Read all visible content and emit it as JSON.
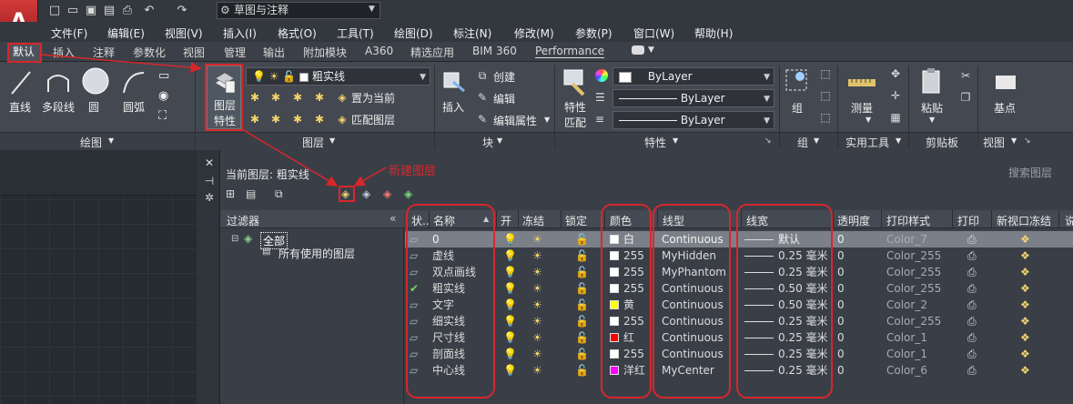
{
  "workspace": "草图与注释",
  "menu": [
    "文件(F)",
    "编辑(E)",
    "视图(V)",
    "插入(I)",
    "格式(O)",
    "工具(T)",
    "绘图(D)",
    "标注(N)",
    "修改(M)",
    "参数(P)",
    "窗口(W)",
    "帮助(H)"
  ],
  "tabs": [
    "默认",
    "插入",
    "注释",
    "参数化",
    "视图",
    "管理",
    "输出",
    "附加模块",
    "A360",
    "精选应用",
    "BIM 360",
    "Performance"
  ],
  "draw_tools": {
    "line": "直线",
    "polyline": "多段线",
    "circle": "圆",
    "arc": "圆弧"
  },
  "layer_tools": {
    "props_line1": "图层",
    "props_line2": "特性",
    "current_layer": "粗实线",
    "set_current": "置为当前",
    "match_layer": "匹配图层"
  },
  "block_tools": {
    "insert": "插入",
    "create": "创建",
    "edit": "编辑",
    "edit_attr": "编辑属性"
  },
  "props": {
    "match_line1": "特性",
    "match_line2": "匹配",
    "color": "ByLayer",
    "linetype": "ByLayer",
    "lineweight": "ByLayer"
  },
  "group_tools": {
    "group": "组"
  },
  "util_tools": {
    "measure": "测量"
  },
  "clip_tools": {
    "paste": "粘贴"
  },
  "base_tools": {
    "base": "基点"
  },
  "panels": {
    "draw": "绘图",
    "layer": "图层",
    "block": "块",
    "props": "特性",
    "group": "组",
    "util": "实用工具",
    "clipboard": "剪贴板",
    "view": "视图"
  },
  "palette": {
    "current_layer_label": "当前图层: 粗实线",
    "search_placeholder": "搜索图层",
    "annotation": "新建图层",
    "filter_header": "过滤器",
    "filter_all": "全部",
    "filter_used": "所有使用的图层"
  },
  "columns": [
    "状..",
    "名称",
    "开",
    "冻结",
    "锁定",
    "颜色",
    "线型",
    "线宽",
    "透明度",
    "打印样式",
    "打印",
    "新视口冻结",
    "说"
  ],
  "layers": [
    {
      "name": "0",
      "color_name": "白",
      "color_hex": "#ffffff",
      "linetype": "Continuous",
      "lineweight": "默认",
      "transparency": "0",
      "plot_style": "Color_7",
      "current": false,
      "selected": true
    },
    {
      "name": "虚线",
      "color_name": "255",
      "color_hex": "#ffffff",
      "linetype": "MyHidden",
      "lineweight": "0.25 毫米",
      "transparency": "0",
      "plot_style": "Color_255",
      "current": false,
      "selected": false
    },
    {
      "name": "双点画线",
      "color_name": "255",
      "color_hex": "#ffffff",
      "linetype": "MyPhantom",
      "lineweight": "0.25 毫米",
      "transparency": "0",
      "plot_style": "Color_255",
      "current": false,
      "selected": false
    },
    {
      "name": "粗实线",
      "color_name": "255",
      "color_hex": "#ffffff",
      "linetype": "Continuous",
      "lineweight": "0.50 毫米",
      "transparency": "0",
      "plot_style": "Color_255",
      "current": true,
      "selected": false
    },
    {
      "name": "文字",
      "color_name": "黄",
      "color_hex": "#ffff00",
      "linetype": "Continuous",
      "lineweight": "0.50 毫米",
      "transparency": "0",
      "plot_style": "Color_2",
      "current": false,
      "selected": false
    },
    {
      "name": "细实线",
      "color_name": "255",
      "color_hex": "#ffffff",
      "linetype": "Continuous",
      "lineweight": "0.25 毫米",
      "transparency": "0",
      "plot_style": "Color_255",
      "current": false,
      "selected": false
    },
    {
      "name": "尺寸线",
      "color_name": "红",
      "color_hex": "#ff0000",
      "linetype": "Continuous",
      "lineweight": "0.25 毫米",
      "transparency": "0",
      "plot_style": "Color_1",
      "current": false,
      "selected": false
    },
    {
      "name": "剖面线",
      "color_name": "255",
      "color_hex": "#ffffff",
      "linetype": "Continuous",
      "lineweight": "0.25 毫米",
      "transparency": "0",
      "plot_style": "Color_1",
      "current": false,
      "selected": false
    },
    {
      "name": "中心线",
      "color_name": "洋红",
      "color_hex": "#ff00ff",
      "linetype": "MyCenter",
      "lineweight": "0.25 毫米",
      "transparency": "0",
      "plot_style": "Color_6",
      "current": false,
      "selected": false
    }
  ],
  "colors": {
    "annotation_red": "#d8262b",
    "accent": "#4f8bd6"
  }
}
